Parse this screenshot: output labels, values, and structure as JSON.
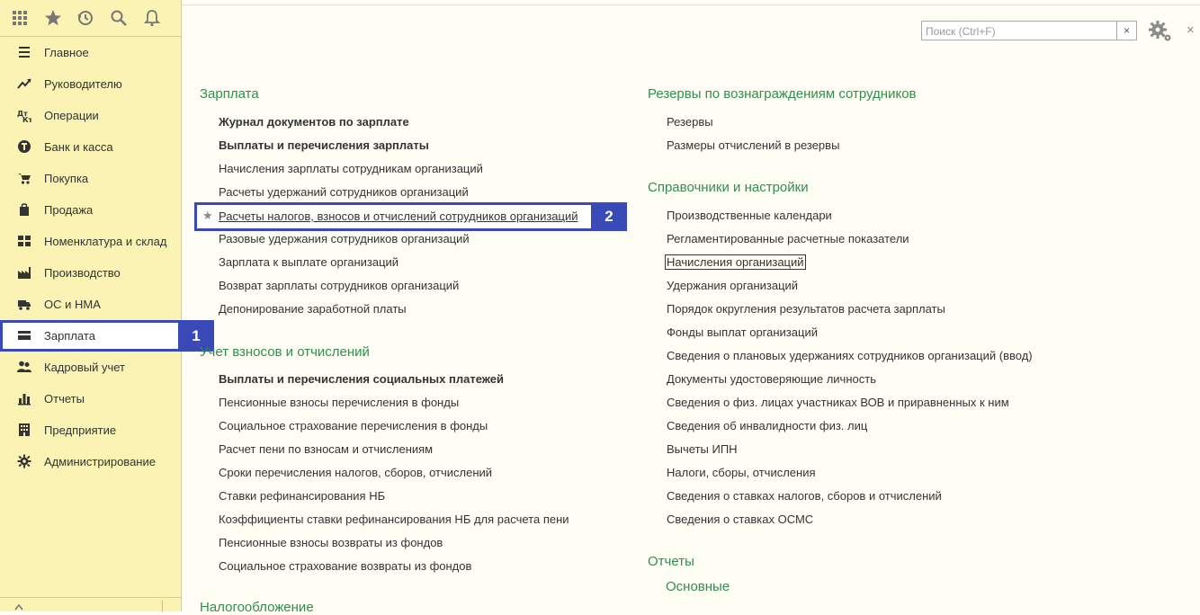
{
  "topbar": {
    "icons": [
      "apps-grid-icon",
      "star-icon",
      "history-icon",
      "search-icon",
      "bell-icon"
    ]
  },
  "sidebar": {
    "items": [
      {
        "label": "Главное",
        "icon": "list-icon"
      },
      {
        "label": "Руководителю",
        "icon": "trend-icon"
      },
      {
        "label": "Операции",
        "icon": "dt-kt-icon"
      },
      {
        "label": "Банк и касса",
        "icon": "coin-icon"
      },
      {
        "label": "Покупка",
        "icon": "cart-icon"
      },
      {
        "label": "Продажа",
        "icon": "bag-icon"
      },
      {
        "label": "Номенклатура и склад",
        "icon": "warehouse-icon"
      },
      {
        "label": "Производство",
        "icon": "factory-icon"
      },
      {
        "label": "ОС и НМА",
        "icon": "truck-icon"
      },
      {
        "label": "Зарплата",
        "icon": "wallet-icon",
        "active": true
      },
      {
        "label": "Кадровый учет",
        "icon": "people-icon"
      },
      {
        "label": "Отчеты",
        "icon": "chart-icon"
      },
      {
        "label": "Предприятие",
        "icon": "building-icon"
      },
      {
        "label": "Администрирование",
        "icon": "gear-icon"
      }
    ]
  },
  "callouts": {
    "one": "1",
    "two": "2"
  },
  "search": {
    "placeholder": "Поиск (Ctrl+F)",
    "value": "",
    "clear": "×"
  },
  "window": {
    "close": "×"
  },
  "left": {
    "salary": {
      "title": "Зарплата",
      "links": [
        {
          "label": "Журнал документов по зарплате",
          "bold": true
        },
        {
          "label": "Выплаты и перечисления зарплаты",
          "bold": true
        },
        {
          "label": "Начисления зарплаты сотрудникам организаций"
        },
        {
          "label": "Расчеты удержаний сотрудников организаций"
        },
        {
          "label": "Расчеты налогов, взносов и отчислений сотрудников организаций",
          "highlighted": true
        },
        {
          "label": "Разовые удержания сотрудников организаций"
        },
        {
          "label": "Зарплата к выплате организаций"
        },
        {
          "label": "Возврат зарплаты сотрудников организаций"
        },
        {
          "label": "Депонирование заработной платы"
        }
      ]
    },
    "contrib": {
      "title": "Учет взносов и отчислений",
      "links": [
        {
          "label": "Выплаты и перечисления социальных платежей",
          "bold": true
        },
        {
          "label": "Пенсионные взносы перечисления в фонды"
        },
        {
          "label": "Социальное страхование перечисления в фонды"
        },
        {
          "label": "Расчет пени по взносам и отчислениям"
        },
        {
          "label": "Сроки перечисления налогов, сборов, отчислений"
        },
        {
          "label": "Ставки рефинансирования НБ"
        },
        {
          "label": "Коэффициенты ставки рефинансирования НБ для расчета пени"
        },
        {
          "label": "Пенсионные взносы возвраты из фондов"
        },
        {
          "label": "Социальное страхование возвраты из фондов"
        }
      ]
    },
    "tax": {
      "title": "Налогообложение"
    }
  },
  "right": {
    "reserves": {
      "title": "Резервы по вознаграждениям сотрудников",
      "links": [
        {
          "label": "Резервы"
        },
        {
          "label": "Размеры отчислений в резервы"
        }
      ]
    },
    "refs": {
      "title": "Справочники и настройки",
      "links": [
        {
          "label": "Производственные календари"
        },
        {
          "label": "Регламентированные расчетные показатели"
        },
        {
          "label": "Начисления организаций",
          "focused": true
        },
        {
          "label": "Удержания организаций"
        },
        {
          "label": "Порядок округления результатов расчета зарплаты"
        },
        {
          "label": "Фонды выплат организаций"
        },
        {
          "label": "Сведения о плановых удержаниях сотрудников организаций (ввод)"
        },
        {
          "label": "Документы удостоверяющие личность"
        },
        {
          "label": "Сведения о физ. лицах участниках ВОВ и приравненных к ним"
        },
        {
          "label": "Сведения об инвалидности физ. лиц"
        },
        {
          "label": "Вычеты ИПН"
        },
        {
          "label": "Налоги, сборы, отчисления"
        },
        {
          "label": "Сведения о ставках налогов, сборов и отчислений"
        },
        {
          "label": "Сведения о ставках ОСМС"
        }
      ]
    },
    "reports": {
      "title": "Отчеты",
      "subtitle": "Основные"
    }
  },
  "colors": {
    "accent": "#3949b8",
    "section": "#2f8f4e",
    "sidebar": "#faf3b4"
  }
}
